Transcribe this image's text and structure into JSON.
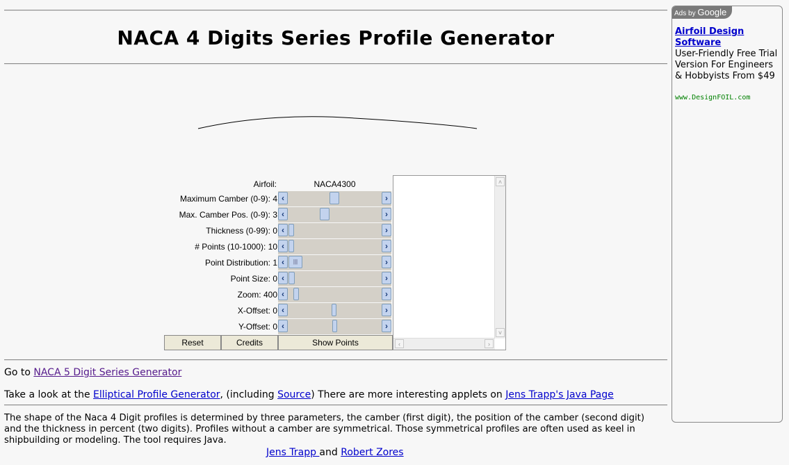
{
  "page_title": "NACA 4 Digits Series Profile Generator",
  "applet": {
    "airfoil_label": "Airfoil:",
    "airfoil_value": "NACA4300",
    "params": [
      {
        "label": "Maximum Camber (0-9): 4",
        "value": 4,
        "min": 0,
        "max": 9
      },
      {
        "label": "Max. Camber Pos. (0-9): 3",
        "value": 3,
        "min": 0,
        "max": 9
      },
      {
        "label": "Thickness (0-99): 0",
        "value": 0,
        "min": 0,
        "max": 99
      },
      {
        "label": "# Points (10-1000): 10",
        "value": 10,
        "min": 10,
        "max": 1000
      },
      {
        "label": "Point Distribution: 1",
        "value": 1
      },
      {
        "label": "Point Size: 0",
        "value": 0
      },
      {
        "label": "Zoom: 400",
        "value": 400
      },
      {
        "label": "X-Offset: 0",
        "value": 0
      },
      {
        "label": "Y-Offset: 0",
        "value": 0
      }
    ],
    "buttons": {
      "reset": "Reset",
      "credits": "Credits",
      "show_points": "Show Points"
    },
    "arrow_left": "‹",
    "arrow_right": "›",
    "grip": "|||",
    "scroll_up": "˄",
    "scroll_down": "˅",
    "scroll_left": "‹",
    "scroll_right": "›"
  },
  "line1": {
    "prefix": "Go to ",
    "link": "NACA 5 Digit Series Generator"
  },
  "line2": {
    "prefix": "Take a look at the ",
    "link1": "Elliptical Profile Generator",
    "mid1": ", (including ",
    "link2": "Source",
    "mid2": ") There are more interesting applets on ",
    "link3": "Jens Trapp's Java Page"
  },
  "description": "The shape of the Naca 4 Digit profiles is determined by three parameters, the camber (first digit), the position of the camber (second digit) and the thickness in percent (two digits). Profiles without a camber are symmetrical. Those symmetrical profiles are often used as keel in shipbuilding or modeling. The tool requires Java.",
  "credits_line": {
    "author1": "Jens Trapp ",
    "conj": "and ",
    "author2": "Robert Zores"
  },
  "ad": {
    "tag_prefix": "Ads by ",
    "tag_brand": "Google",
    "title": "Airfoil Design Software",
    "body": "User-Friendly Free Trial Version For Engineers & Hobbyists From $49",
    "url": "www.DesignFOIL.com"
  }
}
